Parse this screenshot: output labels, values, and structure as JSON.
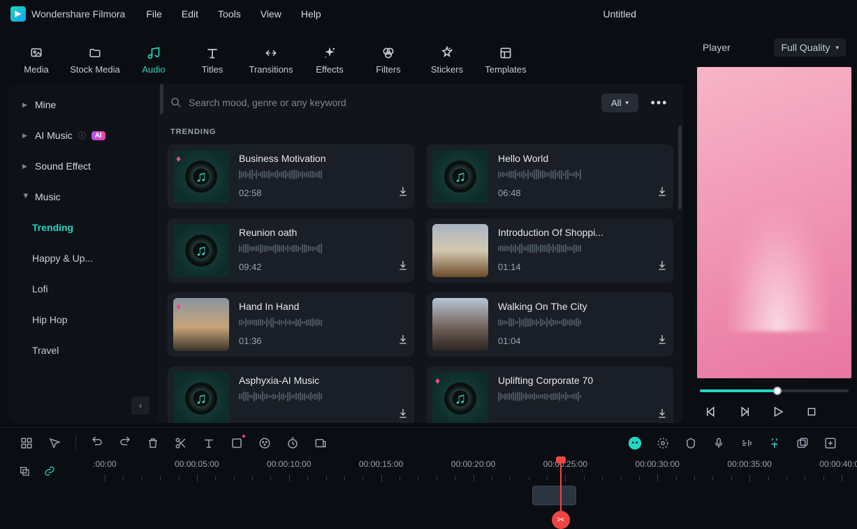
{
  "app_name": "Wondershare Filmora",
  "project_title": "Untitled",
  "menu": [
    "File",
    "Edit",
    "Tools",
    "View",
    "Help"
  ],
  "tool_tabs": [
    {
      "label": "Media",
      "icon": "image"
    },
    {
      "label": "Stock Media",
      "icon": "folder"
    },
    {
      "label": "Audio",
      "icon": "music",
      "active": true
    },
    {
      "label": "Titles",
      "icon": "text"
    },
    {
      "label": "Transitions",
      "icon": "transition"
    },
    {
      "label": "Effects",
      "icon": "sparkle"
    },
    {
      "label": "Filters",
      "icon": "filter"
    },
    {
      "label": "Stickers",
      "icon": "sticker"
    },
    {
      "label": "Templates",
      "icon": "template"
    }
  ],
  "sidebar": {
    "categories": [
      {
        "label": "Mine",
        "collapsed": true
      },
      {
        "label": "AI Music",
        "collapsed": true,
        "ai_badge": "AI",
        "help": true
      },
      {
        "label": "Sound Effect",
        "collapsed": true
      },
      {
        "label": "Music",
        "collapsed": false
      }
    ],
    "music_sub": [
      {
        "label": "Trending",
        "active": true
      },
      {
        "label": "Happy & Up...",
        "active": false
      },
      {
        "label": "Lofi",
        "active": false
      },
      {
        "label": "Hip Hop",
        "active": false
      },
      {
        "label": "Travel",
        "active": false
      }
    ]
  },
  "search": {
    "placeholder": "Search mood, genre or any keyword"
  },
  "filter_label": "All",
  "section_heading": "TRENDING",
  "tracks": [
    {
      "title": "Business Motivation",
      "duration": "02:58",
      "thumb": "music",
      "gem": true
    },
    {
      "title": "Hello World",
      "duration": "06:48",
      "thumb": "music"
    },
    {
      "title": "Reunion oath",
      "duration": "09:42",
      "thumb": "music"
    },
    {
      "title": "Introduction Of Shoppi...",
      "duration": "01:14",
      "thumb": "img1"
    },
    {
      "title": "Hand In Hand",
      "duration": "01:36",
      "thumb": "img2",
      "gem": true
    },
    {
      "title": "Walking On The City",
      "duration": "01:04",
      "thumb": "img3"
    },
    {
      "title": "Asphyxia-AI Music",
      "duration": "",
      "thumb": "music"
    },
    {
      "title": "Uplifting Corporate 70",
      "duration": "",
      "thumb": "music",
      "gem": true
    }
  ],
  "player": {
    "header_label": "Player",
    "quality": "Full Quality",
    "progress_pct": 52
  },
  "timeline": {
    "labels": [
      ":00:00",
      "00:00:05:00",
      "00:00:10:00",
      "00:00:15:00",
      "00:00:20:00",
      "00:00:25:00",
      "00:00:30:00",
      "00:00:35:00",
      "00:00:40:00"
    ],
    "playhead_pos_pct": 64.5
  }
}
